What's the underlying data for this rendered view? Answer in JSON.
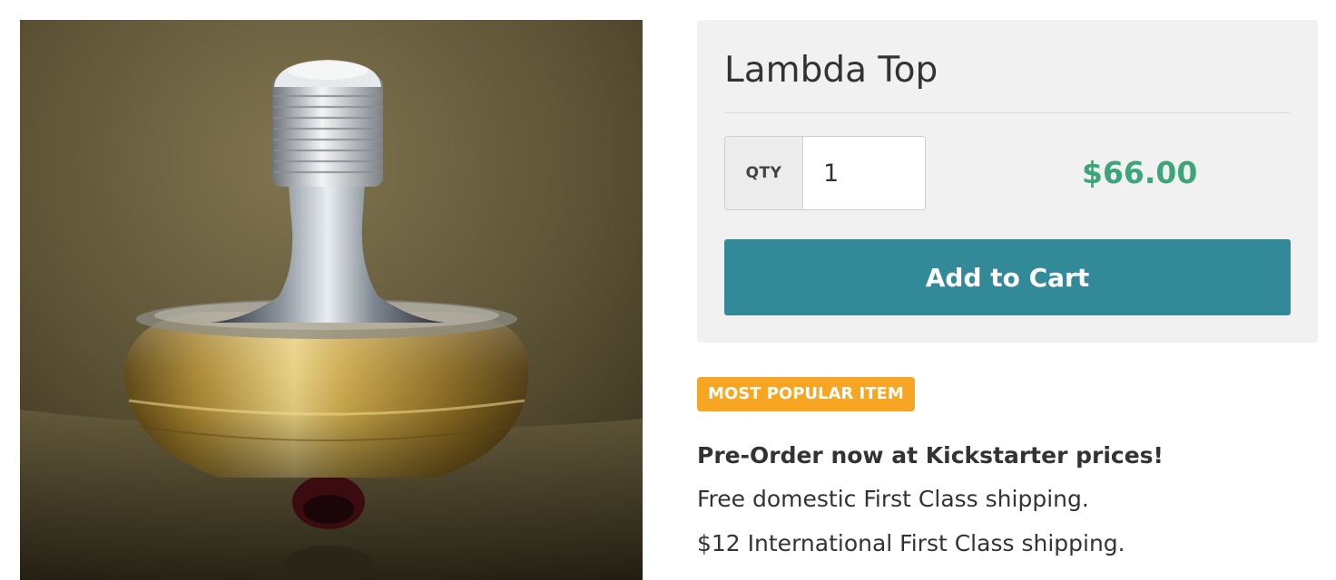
{
  "product": {
    "image_alt": "Lambda Top spinning top with brass body and steel stem",
    "title": "Lambda Top",
    "price": "$66.00"
  },
  "quantity": {
    "label": "QTY",
    "value": "1"
  },
  "actions": {
    "add_to_cart_label": "Add to Cart"
  },
  "badge": {
    "label": "MOST POPULAR ITEM"
  },
  "description": {
    "heading": "Pre-Order now at Kickstarter prices!",
    "lines": [
      "Free domestic First Class shipping.",
      "$12 International First Class shipping."
    ]
  },
  "colors": {
    "accent": "#328a99",
    "price": "#3ea57a",
    "badge": "#f7a623",
    "panel": "#f1f1f1"
  }
}
